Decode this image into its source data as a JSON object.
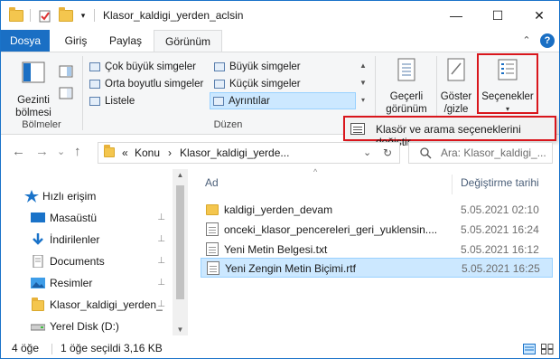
{
  "window": {
    "title": "Klasor_kaldigi_yerden_aclsin",
    "minimize_glyph": "—",
    "maximize_glyph": "☐",
    "close_glyph": "✕"
  },
  "tabs": {
    "file": "Dosya",
    "home": "Giriş",
    "share": "Paylaş",
    "view": "Görünüm",
    "help_glyph": "?",
    "collapse_glyph": "⌃"
  },
  "ribbon": {
    "panes": {
      "nav_pane_label_line1": "Gezinti",
      "nav_pane_label_line2": "bölmesi",
      "group_label": "Bölmeler"
    },
    "layout": {
      "group_label": "Düzen",
      "options": [
        {
          "label": "Çok büyük simgeler"
        },
        {
          "label": "Büyük simgeler"
        },
        {
          "label": "Orta boyutlu simgeler"
        },
        {
          "label": "Küçük simgeler"
        },
        {
          "label": "Listele"
        },
        {
          "label": "Ayrıntılar"
        }
      ],
      "selected": "Ayrıntılar"
    },
    "current_view": {
      "line1": "Geçerli",
      "line2": "görünüm"
    },
    "show_hide": {
      "line1": "Göster",
      "line2": "/gizle"
    },
    "options_button": {
      "label": "Seçenekler"
    }
  },
  "dropdown_menu": {
    "item": "Klasör ve arama seçeneklerini değiştir"
  },
  "address_bar": {
    "back_glyph": "←",
    "forward_glyph": "→",
    "down_glyph": "⌄",
    "up_glyph": "↑",
    "overflow_glyph": "«",
    "crumbs": [
      "Konu",
      "Klasor_kaldigi_yerde..."
    ],
    "sep_glyph": "›",
    "history_glyph": "⌄",
    "refresh_glyph": "↻",
    "search_placeholder": "Ara: Klasor_kaldigi_..."
  },
  "nav_pane": {
    "items": [
      {
        "label": "Hızlı erişim",
        "icon": "star-icon",
        "pinned": false
      },
      {
        "label": "Masaüstü",
        "icon": "desktop-icon",
        "pinned": true
      },
      {
        "label": "İndirilenler",
        "icon": "download-icon",
        "pinned": true
      },
      {
        "label": "Documents",
        "icon": "document-icon",
        "pinned": true
      },
      {
        "label": "Resimler",
        "icon": "pictures-icon",
        "pinned": true
      },
      {
        "label": "Klasor_kaldigi_yerden_",
        "icon": "folder-icon",
        "pinned": true
      },
      {
        "label": "Yerel Disk (D:)",
        "icon": "drive-icon",
        "pinned": false
      }
    ],
    "pin_glyph": "📌"
  },
  "file_list": {
    "columns": {
      "name": "Ad",
      "date": "Değiştirme tarihi"
    },
    "sort_glyph": "^",
    "rows": [
      {
        "name": "kaldigi_yerden_devam",
        "date": "5.05.2021 02:10",
        "type": "folder",
        "selected": false
      },
      {
        "name": "onceki_klasor_pencereleri_geri_yuklensin....",
        "date": "5.05.2021 16:24",
        "type": "file",
        "selected": false
      },
      {
        "name": "Yeni Metin Belgesi.txt",
        "date": "5.05.2021 16:12",
        "type": "file",
        "selected": false
      },
      {
        "name": "Yeni Zengin Metin Biçimi.rtf",
        "date": "5.05.2021 16:25",
        "type": "file",
        "selected": true
      }
    ]
  },
  "status_bar": {
    "item_count": "4 öğe",
    "selection": "1 öğe seçildi  3,16 KB"
  },
  "colors": {
    "accent": "#1a6fc4",
    "highlight_border": "#d9161c",
    "selection_bg": "#cce8ff"
  }
}
